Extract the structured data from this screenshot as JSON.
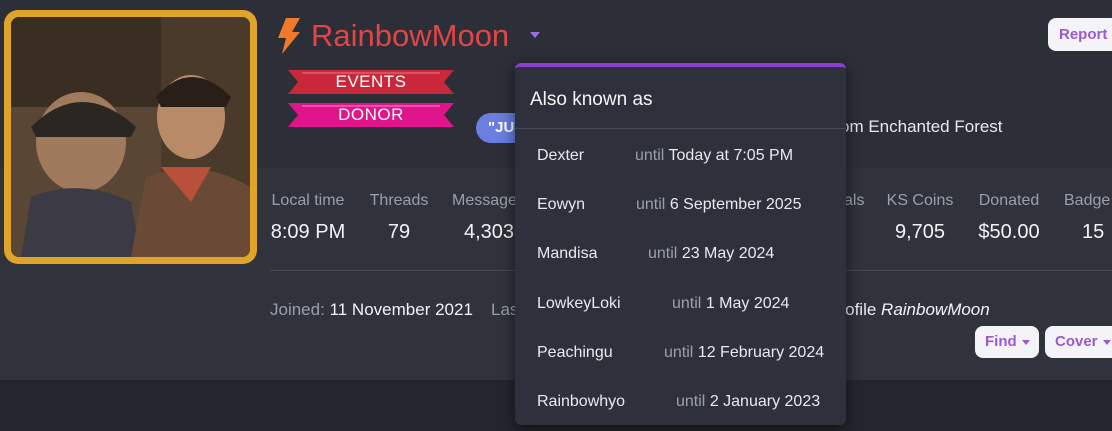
{
  "profile": {
    "username": "RainbowMoon",
    "banners": [
      "EVENTS",
      "DONOR"
    ],
    "quote_partial": "\"JU",
    "location_partial": "om Enchanted Forest",
    "report_label": "Report",
    "icons": {
      "name_prefix": "lightning-bolt-icon",
      "menu": "caret-down-icon"
    },
    "colors": {
      "username": "#e04646",
      "events_banner": "#c8283a",
      "donor_banner": "#e0158c",
      "avatar_frame": "#e0a42a",
      "accent": "#9b59d0"
    }
  },
  "stats": [
    {
      "label": "Local time",
      "value": "8:09 PM"
    },
    {
      "label": "Threads",
      "value": "79"
    },
    {
      "label": "Message",
      "value": "4,303"
    },
    {
      "label": "als",
      "value": ""
    },
    {
      "label": "KS Coins",
      "value": "9,705"
    },
    {
      "label": "Donated",
      "value": "$50.00"
    },
    {
      "label": "Badge",
      "value": "15"
    }
  ],
  "meta": {
    "joined_label": "Joined:",
    "joined_value": "11 November 2021",
    "last_partial": "Las",
    "profile_prefix": "profile",
    "profile_name": "RainbowMoon"
  },
  "actions": {
    "find_label": "Find",
    "cover_label": "Cover"
  },
  "aka": {
    "title": "Also known as",
    "until_word": "until",
    "items": [
      {
        "name": "Dexter",
        "until": "Today at 7:05 PM"
      },
      {
        "name": "Eowyn",
        "until": "6 September 2025"
      },
      {
        "name": "Mandisa",
        "until": "23 May 2024"
      },
      {
        "name": "LowkeyLoki",
        "until": "1 May 2024"
      },
      {
        "name": "Peachingu",
        "until": "12 February 2024"
      },
      {
        "name": "Rainbowhyo",
        "until": "2 January 2023"
      }
    ]
  }
}
